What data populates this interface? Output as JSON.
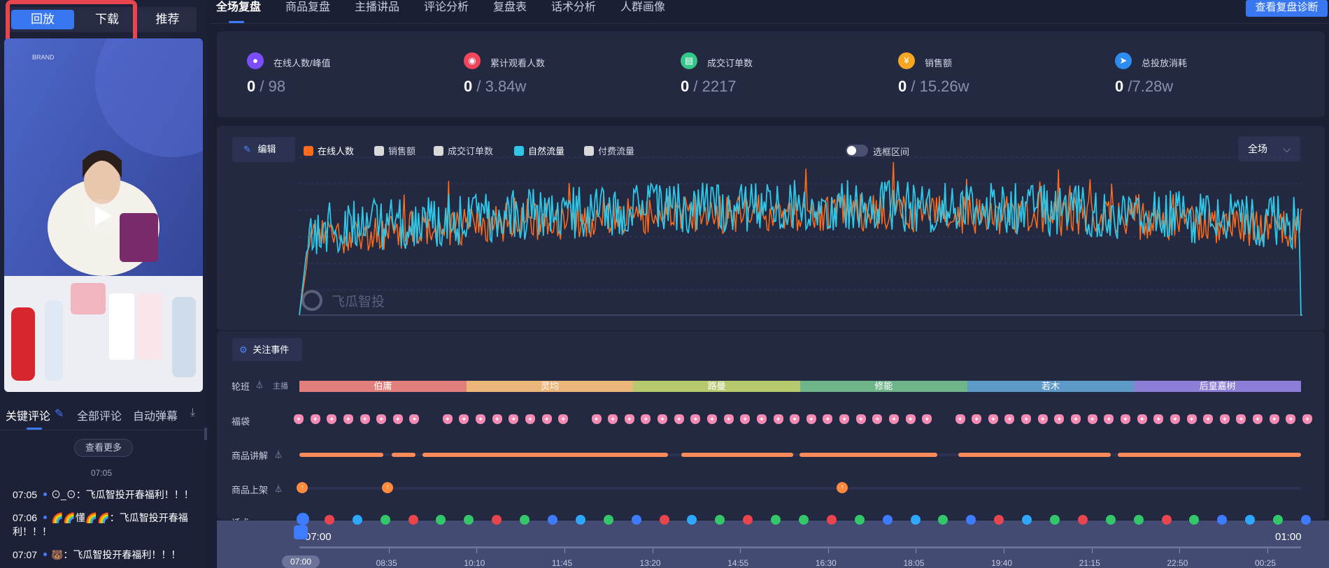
{
  "left": {
    "tabs": [
      "回放",
      "下载",
      "推荐"
    ],
    "comment_tabs": [
      "关键评论",
      "全部评论",
      "自动弹幕"
    ],
    "see_more": "查看更多",
    "time_divider": "07:05",
    "comments": [
      {
        "time": "07:05",
        "text": "⊙_⊙：飞瓜智投开春福利！！！"
      },
      {
        "time": "07:06",
        "text": "🌈🌈懂🌈🌈：飞瓜智投开春福利！！！"
      },
      {
        "time": "07:07",
        "text": "🐻：飞瓜智投开春福利！！！"
      }
    ]
  },
  "nav": {
    "items": [
      "全场复盘",
      "商品复盘",
      "主播讲品",
      "评论分析",
      "复盘表",
      "话术分析",
      "人群画像"
    ],
    "diag_button": "查看复盘诊断"
  },
  "stats": [
    {
      "label": "在线人数/峰值",
      "current": "0",
      "sep": " / ",
      "total": "98",
      "color": "#7c4dff",
      "icon": "user-icon"
    },
    {
      "label": "累计观看人数",
      "current": "0",
      "sep": " / ",
      "total": "3.84w",
      "color": "#f0455a",
      "icon": "eye-icon"
    },
    {
      "label": "成交订单数",
      "current": "0",
      "sep": " / ",
      "total": "2217",
      "color": "#34c78a",
      "icon": "order-icon"
    },
    {
      "label": "销售额",
      "current": "0",
      "sep": " / ",
      "total": "15.26w",
      "color": "#f5a623",
      "icon": "yen-icon"
    },
    {
      "label": "总投放消耗",
      "current": "0",
      "sep": " /",
      "total": "7.28w",
      "color": "#2d8cf0",
      "icon": "send-icon"
    }
  ],
  "toolbar": {
    "edit": "编辑",
    "legend": [
      {
        "label": "在线人数",
        "color": "#ff6b1a",
        "on": true
      },
      {
        "label": "销售额",
        "color": "#d9d9d9",
        "on": false
      },
      {
        "label": "成交订单数",
        "color": "#d9d9d9",
        "on": false
      },
      {
        "label": "自然流量",
        "color": "#2ec7e8",
        "on": true
      },
      {
        "label": "付费流量",
        "color": "#d9d9d9",
        "on": false
      }
    ],
    "range_toggle": "选框区间",
    "scope_select": "全场"
  },
  "watermark": "飞瓜智投",
  "chart_data": {
    "type": "line",
    "series": [
      {
        "name": "在线人数",
        "color": "#ff6b1a"
      },
      {
        "name": "自然流量",
        "color": "#2ec7e8"
      }
    ],
    "grid": true
  },
  "events": {
    "button": "关注事件",
    "rows": [
      "轮班",
      "福袋",
      "商品讲解",
      "商品上架",
      "话术"
    ],
    "anchor_tag": "主播",
    "shifts": [
      {
        "name": "伯庸",
        "color": "#e07f7b"
      },
      {
        "name": "灵均",
        "color": "#eab67a"
      },
      {
        "name": "路曼",
        "color": "#b6c96e"
      },
      {
        "name": "修能",
        "color": "#6fb58a"
      },
      {
        "name": "若木",
        "color": "#5e9ac8"
      },
      {
        "name": "后皇嘉树",
        "color": "#8c7ed6"
      }
    ]
  },
  "timeline": {
    "start": "07:00",
    "end": "01:00",
    "ticks": [
      "07:00",
      "08:35",
      "10:10",
      "11:45",
      "13:20",
      "14:55",
      "16:30",
      "18:05",
      "19:40",
      "21:15",
      "22:50",
      "00:25"
    ]
  }
}
